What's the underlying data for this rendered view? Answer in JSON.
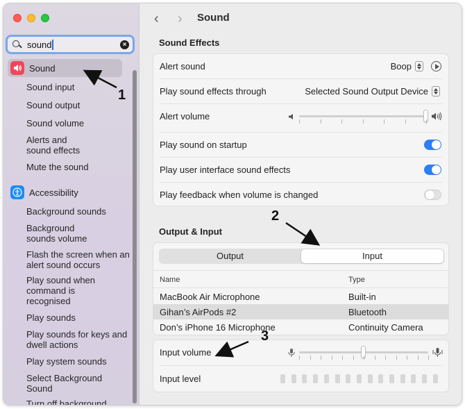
{
  "search": {
    "value": "sound"
  },
  "sidebar": {
    "selected": {
      "label": "Sound",
      "icon": "speaker-icon"
    },
    "sound_subitems": [
      "Sound input",
      "Sound output",
      "Sound volume",
      "Alerts and sound effects",
      "Mute the sound"
    ],
    "accessibility": {
      "label": "Accessibility",
      "icon": "accessibility-icon"
    },
    "accessibility_subitems": [
      "Background sounds",
      "Background sounds volume",
      "Flash the screen when an alert sound occurs",
      "Play sound when command is recognised",
      "Play sounds",
      "Play sounds for keys and dwell actions",
      "Play system sounds",
      "Select Background Sound",
      "Turn off background"
    ]
  },
  "toolbar": {
    "title": "Sound"
  },
  "sound_effects": {
    "title": "Sound Effects",
    "alert_sound_label": "Alert sound",
    "alert_sound_value": "Boop",
    "play_through_label": "Play sound effects through",
    "play_through_value": "Selected Sound Output Device",
    "alert_volume_label": "Alert volume",
    "alert_volume_level": 1.0,
    "startup_label": "Play sound on startup",
    "startup_on": true,
    "ui_effects_label": "Play user interface sound effects",
    "ui_effects_on": true,
    "feedback_label": "Play feedback when volume is changed",
    "feedback_on": false
  },
  "output_input": {
    "title": "Output & Input",
    "tabs": [
      "Output",
      "Input"
    ],
    "active_tab": "Input",
    "columns": [
      "Name",
      "Type"
    ],
    "devices": [
      {
        "name": "MacBook Air Microphone",
        "type": "Built-in",
        "selected": false
      },
      {
        "name": "Gihan’s AirPods #2",
        "type": "Bluetooth",
        "selected": true
      },
      {
        "name": "Don’s iPhone 16 Microphone",
        "type": "Continuity Camera",
        "selected": false
      }
    ],
    "input_volume_label": "Input volume",
    "input_volume_level": 0.5,
    "input_level_label": "Input level"
  },
  "annotations": [
    "1",
    "2",
    "3"
  ],
  "colors": {
    "accent": "#2c7ef5",
    "sound_icon": "#f0475c",
    "accessibility_icon": "#1c8cf2",
    "search_focus": "#7aa7e8"
  }
}
